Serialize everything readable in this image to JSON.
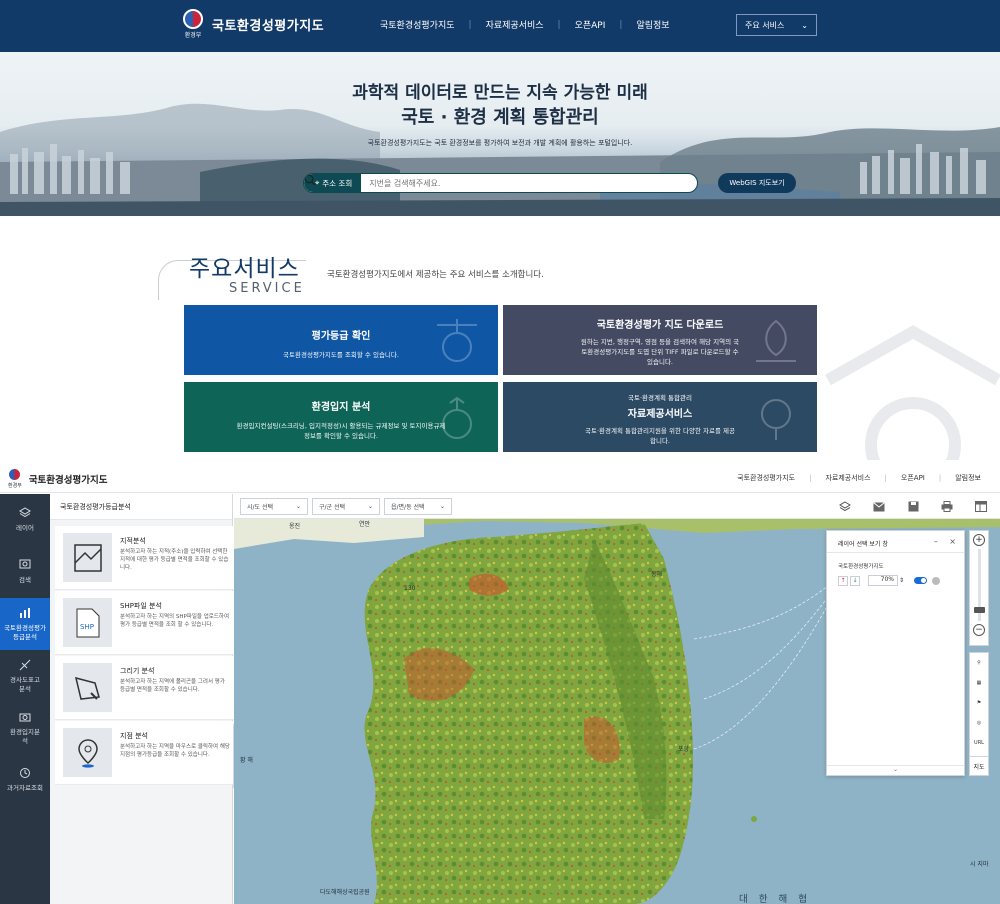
{
  "portal": {
    "brand": "국토환경성평가지도",
    "emblem_caption": "환경부",
    "nav": [
      "국토환경성평가지도",
      "자료제공서비스",
      "오픈API",
      "알림정보"
    ],
    "service_select": "주요 서비스"
  },
  "hero": {
    "title1": "과학적 데이터로 만드는 지속 가능한 미래",
    "title2": "국토 · 환경 계획 통합관리",
    "desc": "국토환경성평가지도는 국토 환경정보를 평가하여 보전과 개발 계획에 활용하는 포털입니다.",
    "search_label": "주소 조회",
    "search_placeholder": "지번을 검색해주세요.",
    "webgis_button": "WebGIS 지도보기"
  },
  "services": {
    "title": "주요서비스",
    "subtitle": "SERVICE",
    "desc": "국토환경성평가지도에서 제공하는 주요 서비스를 소개합니다.",
    "cards": [
      {
        "title": "평가등급 확인",
        "desc": "국토환경성평가지도를 조회할 수 있습니다."
      },
      {
        "title": "국토환경성평가 지도 다운로드",
        "desc": "원하는 지번, 행정구역, 영점 등을 검색하여 해당 지역의 국토환경성평가지도를 도엽 단위 TIFF 파일로 다운로드할 수 있습니다."
      },
      {
        "title": "환경입지 분석",
        "desc": "환경입지컨설팅(스크리닝, 입지적정성)시 활용되는 규제정보 및 토지이용규제정보를 확인할 수 있습니다."
      },
      {
        "pre": "국토·환경계획 통합관리",
        "title": "자료제공서비스",
        "desc": "국토·환경계획 통합관리지원을 위한 다양한 자료를 제공합니다."
      }
    ]
  },
  "app": {
    "brand": "국토환경성평가지도",
    "emblem_caption": "환경부",
    "nav": [
      "국토환경성평가지도",
      "자료제공서비스",
      "오픈API",
      "알림정보"
    ],
    "rail": [
      "레이어",
      "검색",
      "국토환경성평가등급분석",
      "경사도표고분석",
      "환경입지분석",
      "과거자료조회"
    ],
    "panel_title": "국토환경성평가등급분석",
    "analyses": [
      {
        "title": "지적분석",
        "desc": "분석하고자 하는 지적(주소)을 입력하여 선택한 지적에 대한 평가 등급별 면적을 조회할 수 있습니다."
      },
      {
        "title": "SHP파일 분석",
        "desc": "분석하고자 하는 지역의 SHP파일을 업로드하여 평가 등급별 면적을 조회 할 수 있습니다.",
        "badge": "SHP"
      },
      {
        "title": "그리기 분석",
        "desc": "분석하고자 하는 지역에 폴리곤을 그려서 평가 등급별 면적을 조회할 수 있습니다."
      },
      {
        "title": "지점 분석",
        "desc": "분석하고자 하는 지역을 마우스로 클릭하여 해당 지점의 평가등급을 조회할 수 있습니다."
      }
    ],
    "selects": [
      "시/도 선택",
      "구/군 선택",
      "읍/면/동 선택"
    ],
    "layer_window": {
      "title": "레이어 선택 보기 창",
      "layer_name": "국토환경성평가지도",
      "opacity": "70%"
    },
    "map_labels": {
      "sea_east": "대 한 해 협",
      "east_sea": "동 해",
      "tsushima": "시 지마",
      "city_pohang": "포항",
      "city_ulleung": "울릉",
      "island": "다도해해상국립공원",
      "n1": "옹진",
      "n2": "연안",
      "route": "130",
      "gangneung": "동해",
      "sea_west": "황 해"
    },
    "right_tools": [
      "URL",
      "지도"
    ]
  }
}
